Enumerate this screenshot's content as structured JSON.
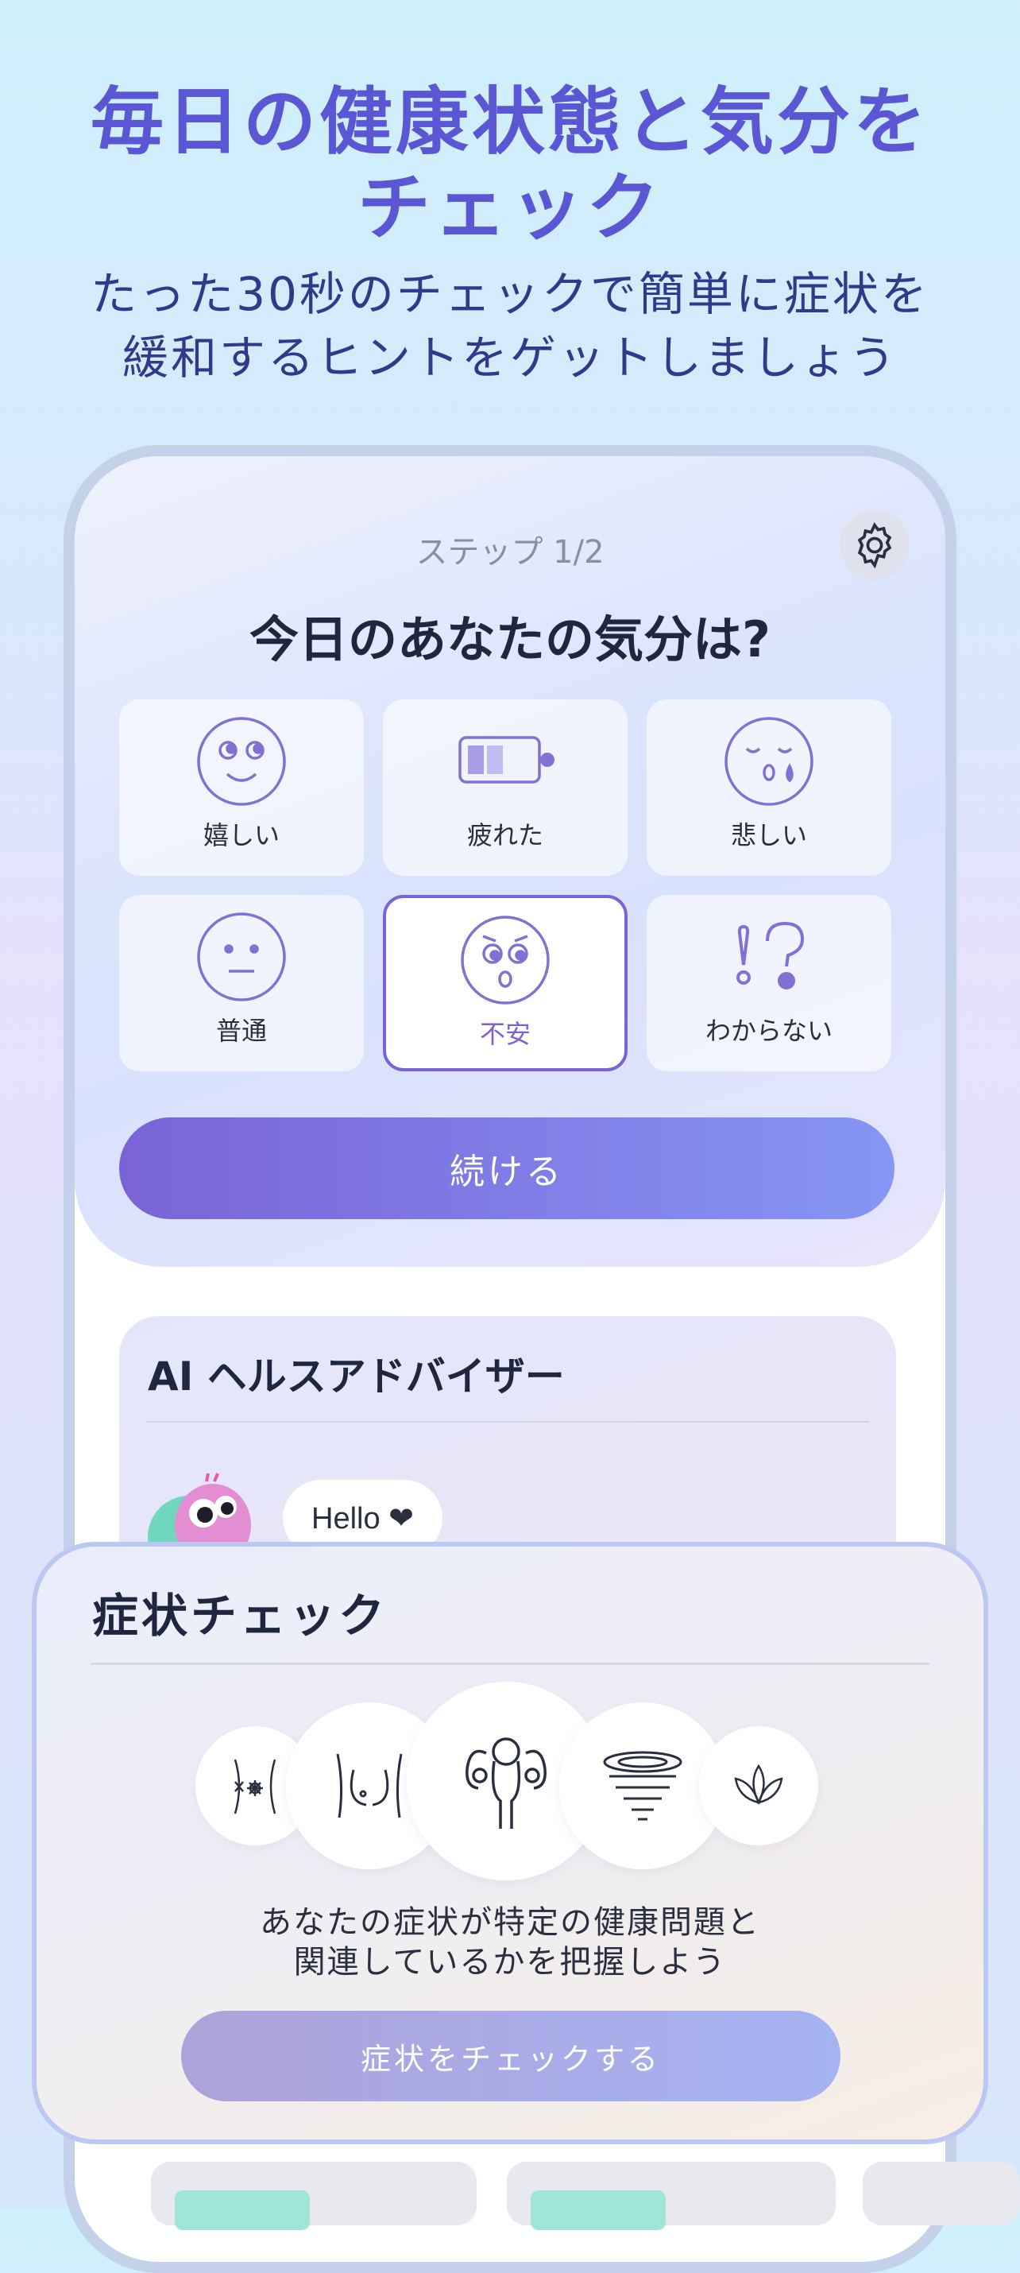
{
  "header": {
    "headline_line1": "毎日の健康状態と気分を",
    "headline_line2": "チェック",
    "subline_line1": "たった30秒のチェックで簡単に症状を",
    "subline_line2": "緩和するヒントをゲットしましょう"
  },
  "mood_check": {
    "step": "ステップ 1/2",
    "question": "今日のあなたの気分は?",
    "options": [
      {
        "label": "嬉しい",
        "icon": "happy-face-icon"
      },
      {
        "label": "疲れた",
        "icon": "low-battery-icon"
      },
      {
        "label": "悲しい",
        "icon": "sad-face-icon"
      },
      {
        "label": "普通",
        "icon": "neutral-face-icon"
      },
      {
        "label": "不安",
        "icon": "anxious-face-icon"
      },
      {
        "label": "わからない",
        "icon": "exclaim-question-icon"
      }
    ],
    "selected": "不安",
    "continue_label": "続ける"
  },
  "ai_advisor": {
    "title": "AI ヘルスアドバイザー",
    "greeting": "Hello ❤"
  },
  "symptom_check": {
    "title": "症状チェック",
    "description_line1": "あなたの症状が特定の健康問題と",
    "description_line2": "関連しているかを把握しよう",
    "button_label": "症状をチェックする",
    "icons": [
      "abdomen-icon",
      "breast-icon",
      "uterus-icon",
      "tornado-icon",
      "lotus-icon"
    ]
  },
  "colors": {
    "accent": "#7a63d6",
    "headline": "#5b57d4",
    "button_gradient_end": "#8596f4"
  }
}
